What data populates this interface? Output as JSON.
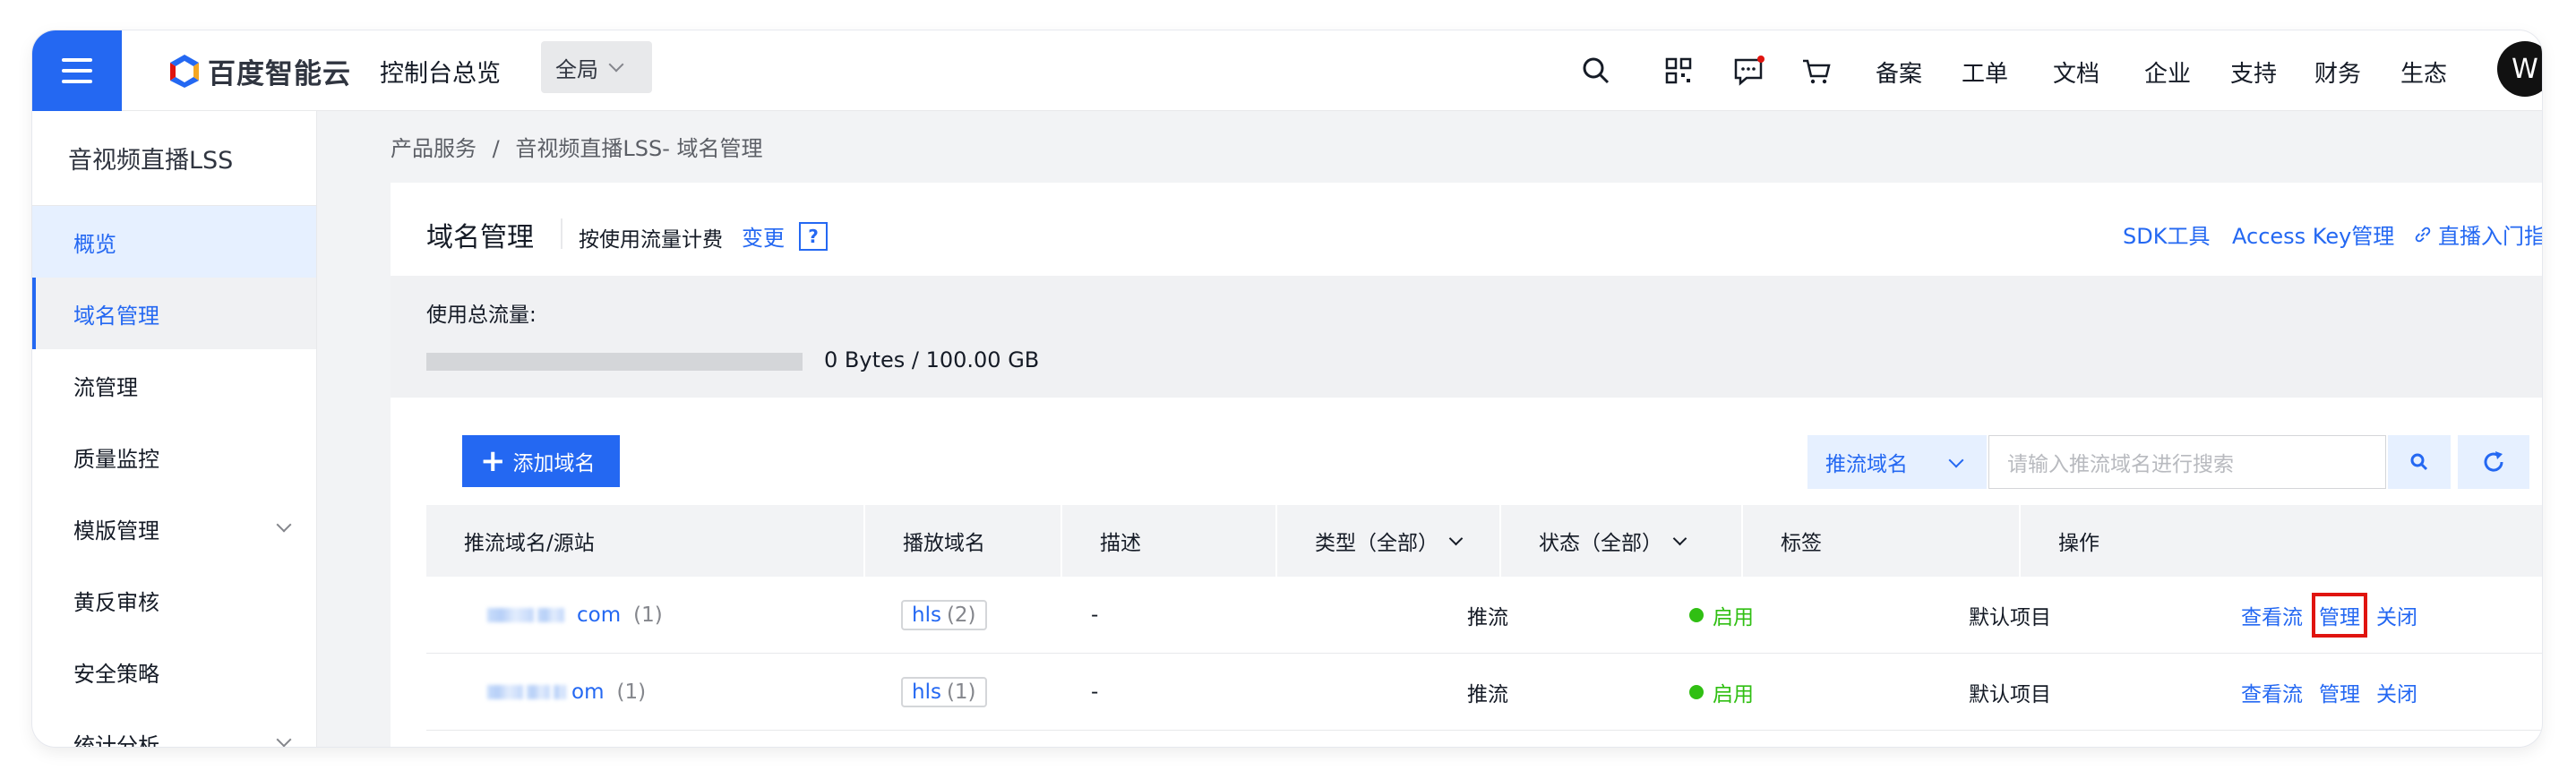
{
  "topbar": {
    "logo_text": "百度智能云",
    "console_title": "控制台总览",
    "scope_label": "全局",
    "nav": [
      "备案",
      "工单",
      "文档",
      "企业",
      "支持",
      "财务",
      "生态"
    ],
    "avatar_initial": "W",
    "icons": [
      "search-icon",
      "qrcode-icon",
      "message-icon",
      "cart-icon"
    ],
    "brand_color": "#2468f2"
  },
  "sidebar": {
    "title": "音视频直播LSS",
    "items": [
      {
        "label": "概览",
        "state": "overview"
      },
      {
        "label": "域名管理",
        "state": "active"
      },
      {
        "label": "流管理"
      },
      {
        "label": "质量监控"
      },
      {
        "label": "模版管理",
        "expandable": true
      },
      {
        "label": "黄反审核"
      },
      {
        "label": "安全策略"
      },
      {
        "label": "统计分析",
        "expandable": true
      }
    ]
  },
  "breadcrumb": {
    "root": "产品服务",
    "separator": "/",
    "current": "音视频直播LSS- 域名管理"
  },
  "header": {
    "title": "域名管理",
    "billing": "按使用流量计费",
    "change": "变更",
    "help": "?",
    "links": [
      "SDK工具",
      "Access Key管理",
      "直播入门指南"
    ]
  },
  "usage": {
    "label": "使用总流量:",
    "value_text": "0 Bytes / 100.00 GB",
    "fraction": 0
  },
  "toolbar": {
    "add_label": "添加域名",
    "search_type": "推流域名",
    "search_placeholder": "请输入推流域名进行搜索"
  },
  "table": {
    "headers": [
      "推流域名/源站",
      "播放域名",
      "描述",
      "类型（全部）",
      "状态（全部）",
      "标签",
      "操作"
    ],
    "rows": [
      {
        "domain_suffix": "com",
        "domain_count": "(1)",
        "play": "hls",
        "play_count": "(2)",
        "desc": "-",
        "type": "推流",
        "status": "启用",
        "tag": "默认项目",
        "ops": [
          "查看流",
          "管理",
          "关闭"
        ],
        "highlight_op": "管理"
      },
      {
        "domain_suffix": "om",
        "domain_count": "(1)",
        "play": "hls",
        "play_count": "(1)",
        "desc": "-",
        "type": "推流",
        "status": "启用",
        "tag": "默认项目",
        "ops": [
          "查看流",
          "管理",
          "关闭"
        ]
      }
    ]
  }
}
